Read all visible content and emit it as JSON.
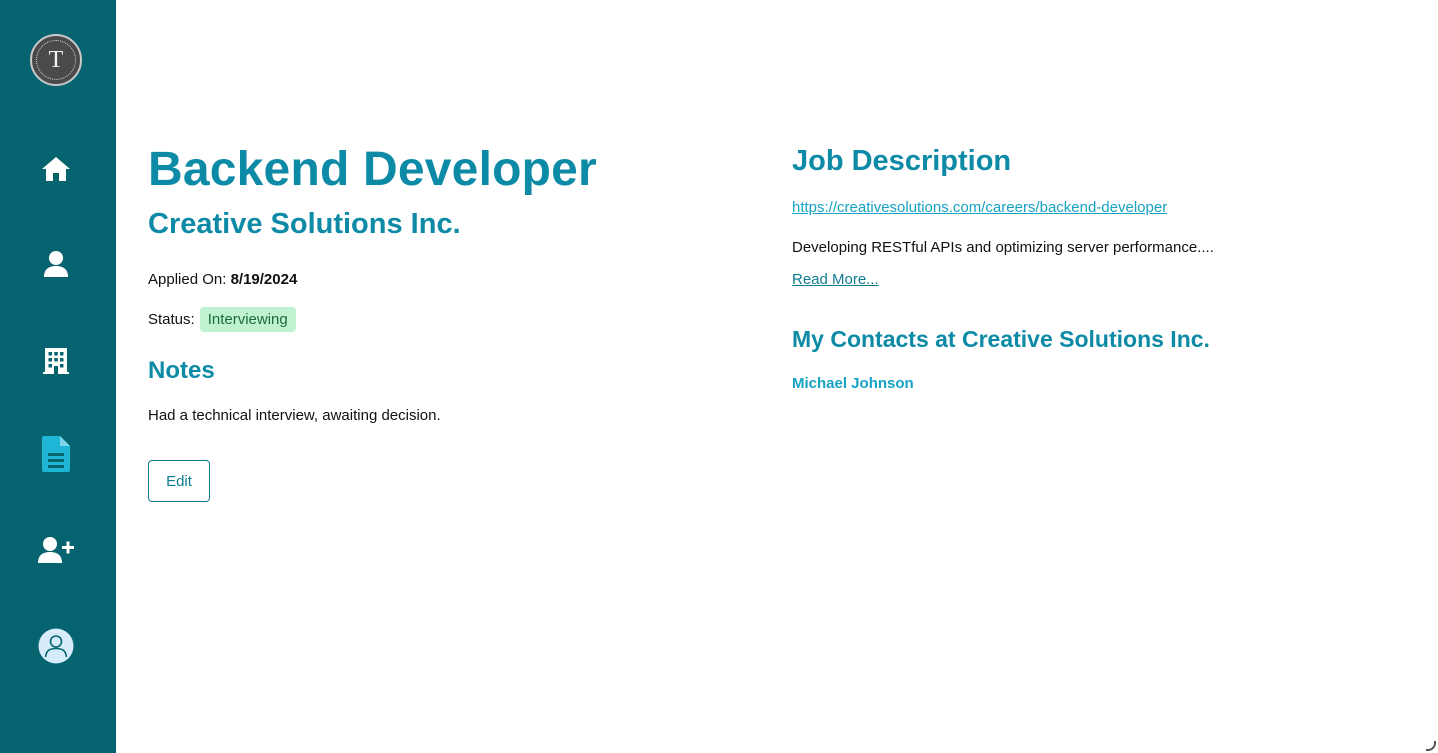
{
  "sidebar": {
    "logo_letter": "T",
    "items": [
      {
        "icon": "home-icon",
        "label": "Home"
      },
      {
        "icon": "user-icon",
        "label": "Profile"
      },
      {
        "icon": "building-icon",
        "label": "Companies"
      },
      {
        "icon": "document-icon",
        "label": "Applications",
        "active": true
      },
      {
        "icon": "user-plus-icon",
        "label": "Contacts"
      },
      {
        "icon": "account-circle-icon",
        "label": "Account"
      }
    ],
    "colors": {
      "background": "#05646f",
      "icon": "#ffffff",
      "active_icon": "#1fb5d6"
    }
  },
  "job": {
    "title": "Backend Developer",
    "company": "Creative Solutions Inc.",
    "applied_label": "Applied On:",
    "applied_date": "8/19/2024",
    "status_label": "Status:",
    "status": "Interviewing",
    "notes_heading": "Notes",
    "notes": "Had a technical interview, awaiting decision.",
    "edit_label": "Edit"
  },
  "description": {
    "heading": "Job Description",
    "url": "https://creativesolutions.com/careers/backend-developer",
    "summary": "Developing RESTful APIs and optimizing server performance....",
    "read_more": "Read More..."
  },
  "contacts": {
    "heading": "My Contacts at Creative Solutions Inc.",
    "people": [
      "Michael Johnson"
    ]
  },
  "theme": {
    "accent": "#0d8aa6",
    "link": "#16a3c4",
    "status_bg": "#bff2d0",
    "status_fg": "#1d6b3a"
  }
}
